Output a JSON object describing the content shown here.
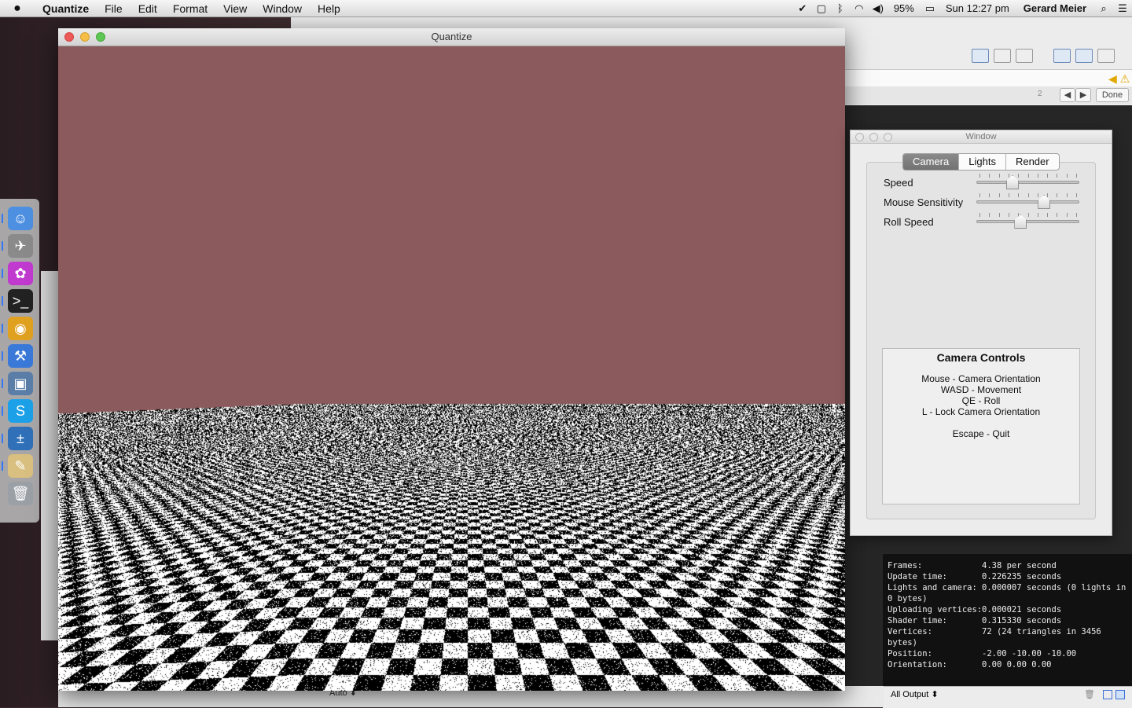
{
  "menubar": {
    "apple_icon": "apple-icon",
    "app_name": "Quantize",
    "items": [
      "File",
      "Edit",
      "Format",
      "View",
      "Window",
      "Help"
    ],
    "battery": "95%",
    "clock": "Sun 12:27 pm",
    "user": "Gerard Meier"
  },
  "main_window": {
    "title": "Quantize",
    "sky_color": "#8b5a5c"
  },
  "inspector": {
    "title": "Window",
    "tabs": [
      "Camera",
      "Lights",
      "Render"
    ],
    "active_tab": "Camera",
    "settings": [
      {
        "label": "Speed",
        "value": 0.33
      },
      {
        "label": "Mouse Sensitivity",
        "value": 0.68
      },
      {
        "label": "Roll Speed",
        "value": 0.42
      }
    ],
    "controls": {
      "title": "Camera Controls",
      "lines": [
        "Mouse - Camera Orientation",
        "WASD - Movement",
        "QE - Roll",
        "L - Lock Camera Orientation",
        "",
        "Escape - Quit"
      ]
    }
  },
  "editor": {
    "find_count": "2",
    "done_label": "Done"
  },
  "console": {
    "rows": [
      {
        "key": "Frames:",
        "value": "4.38 per second"
      },
      {
        "key": "Update time:",
        "value": "0.226235 seconds"
      },
      {
        "key": "Lights and camera:",
        "value": "0.000007 seconds (0 lights in"
      },
      {
        "key": "",
        "value": "0 bytes)"
      },
      {
        "key": "Uploading vertices:",
        "value": "0.000021 seconds"
      },
      {
        "key": "Shader time:",
        "value": "0.315330 seconds"
      },
      {
        "key": "Vertices:",
        "value": "72 (24 triangles in 3456"
      },
      {
        "key": "",
        "value": "bytes)"
      },
      {
        "key": "Position:",
        "value": "-2.00 -10.00 -10.00"
      },
      {
        "key": "Orientation:",
        "value": "0.00 0.00 0.00"
      }
    ],
    "output_select": "All Output ⬍"
  },
  "bottom_bar": {
    "zoom_select": "Auto ⬍"
  },
  "dock": {
    "items": [
      "finder-icon",
      "launchpad-icon",
      "flower-app-icon",
      "terminal-icon",
      "chrome-icon",
      "xcode-icon",
      "preview-icon",
      "skype-icon",
      "calculator-icon",
      "textedit-icon",
      "trash-icon"
    ]
  }
}
